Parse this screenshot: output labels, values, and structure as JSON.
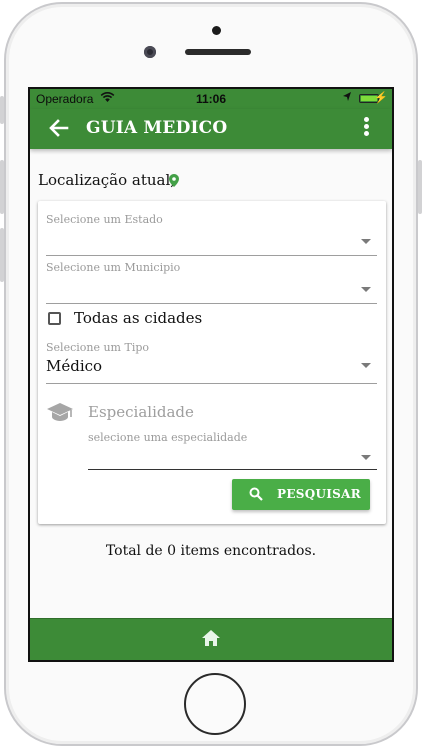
{
  "status_bar": {
    "carrier": "Operadora",
    "time": "11:06"
  },
  "app_bar": {
    "title": "GUIA MEDICO",
    "back_icon": "arrow-left-icon",
    "menu_icon": "more-vert-icon"
  },
  "location": {
    "label": "Localização atual,",
    "icon": "map-pin-icon"
  },
  "form": {
    "estado": {
      "label": "Selecione um Estado",
      "value": ""
    },
    "municipio": {
      "label": "Selecione um Municipio",
      "value": ""
    },
    "todas_cidades": {
      "label": "Todas as cidades",
      "checked": false
    },
    "tipo": {
      "label": "Selecione um Tipo",
      "value": "Médico"
    },
    "especialidade": {
      "title": "Especialidade",
      "label": "selecione uma especialidade",
      "value": "",
      "icon": "graduation-cap-icon"
    },
    "search_button": {
      "label": "PESQUISAR",
      "icon": "search-icon"
    }
  },
  "results": {
    "total_text": "Total de 0 items encontrados."
  },
  "bottom_nav": {
    "icon": "home-icon"
  },
  "colors": {
    "primary": "#3d8b37",
    "button": "#4aae47",
    "pin": "#43a047"
  }
}
